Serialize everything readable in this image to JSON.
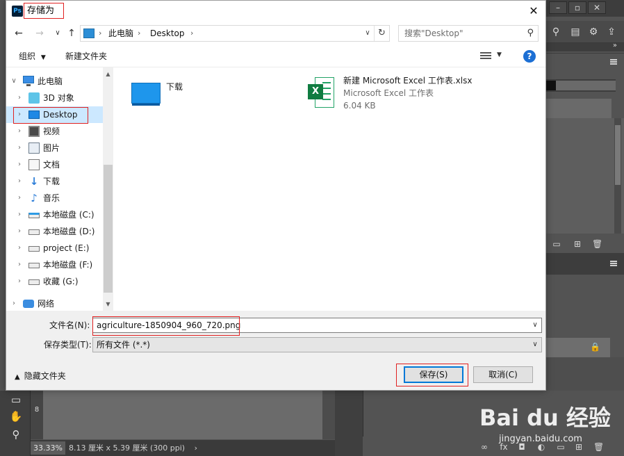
{
  "dialog": {
    "title": "存储为",
    "app_icon_text": "Ps",
    "close_glyph": "✕"
  },
  "address": {
    "segments": [
      "此电脑",
      "Desktop"
    ],
    "search_placeholder": "搜索\"Desktop\""
  },
  "toolbar": {
    "organize": "组织",
    "new_folder": "新建文件夹"
  },
  "nav_tree": [
    {
      "label": "此电脑",
      "icon": "computer-icon"
    },
    {
      "label": "3D 对象",
      "icon": "3d-objects-icon"
    },
    {
      "label": "Desktop",
      "icon": "desktop-icon"
    },
    {
      "label": "视频",
      "icon": "video-icon"
    },
    {
      "label": "图片",
      "icon": "pictures-icon"
    },
    {
      "label": "文档",
      "icon": "documents-icon"
    },
    {
      "label": "下载",
      "icon": "download-icon"
    },
    {
      "label": "音乐",
      "icon": "music-icon"
    },
    {
      "label": "本地磁盘 (C:)",
      "icon": "drive-c-icon"
    },
    {
      "label": "本地磁盘 (D:)",
      "icon": "drive-icon"
    },
    {
      "label": "project (E:)",
      "icon": "drive-icon"
    },
    {
      "label": "本地磁盘 (F:)",
      "icon": "drive-icon"
    },
    {
      "label": "收藏 (G:)",
      "icon": "drive-icon"
    },
    {
      "label": "网络",
      "icon": "network-icon"
    }
  ],
  "files": [
    {
      "name": "下载",
      "type": "folder"
    },
    {
      "name": "新建 Microsoft Excel 工作表.xlsx",
      "kind": "Microsoft Excel 工作表",
      "size": "6.04 KB",
      "type": "excel"
    }
  ],
  "form": {
    "filename_label": "文件名(N):",
    "filename_value": "agriculture-1850904_960_720.png",
    "filetype_label": "保存类型(T):",
    "filetype_value": "所有文件 (*.*)",
    "save_button": "保存(S)",
    "cancel_button": "取消(C)",
    "hide_folders": "隐藏文件夹"
  },
  "photoshop": {
    "zoom": "33.33%",
    "doc_info": "8.13 厘米 x 5.39 厘米 (300 ppi)",
    "ruler_mark": "8"
  },
  "watermark": {
    "logo": "Bai du 经验",
    "url": "jingyan.baidu.com"
  },
  "colors": {
    "selection": "#cce8ff",
    "highlight_box": "#e02020",
    "primary_border": "#0078d7"
  }
}
